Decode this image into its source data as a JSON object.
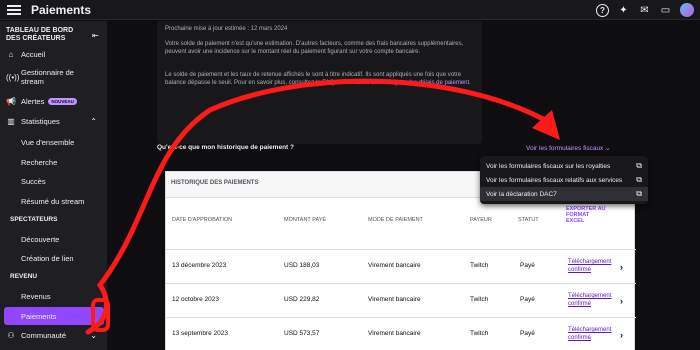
{
  "topbar": {
    "title": "Paiements",
    "icons": [
      "menu-icon",
      "help-icon",
      "sparkle-icon",
      "inbox-icon",
      "chat-icon",
      "avatar"
    ]
  },
  "sidebar": {
    "heading": "TABLEAU DE BORD DES CRÉATEURS",
    "collapse_icon": "collapse-icon",
    "items": [
      {
        "label": "Accueil",
        "icon": "home-icon"
      },
      {
        "label": "Gestionnaire de stream",
        "icon": "broadcast-icon"
      },
      {
        "label": "Alertes",
        "icon": "megaphone-icon",
        "badge": "NOUVEAU"
      },
      {
        "label": "Statistiques",
        "icon": "stats-icon"
      }
    ],
    "stats_sub": [
      "Vue d'ensemble",
      "Recherche",
      "Succès",
      "Résumé du stream"
    ],
    "section_spectateurs": "SPECTATEURS",
    "spect_sub": [
      "Découverte",
      "Création de lien"
    ],
    "section_revenu": "REVENU",
    "revenu_sub": [
      "Revenus",
      "Paiements"
    ],
    "community": "Communauté"
  },
  "infobox": {
    "line0": "Prochaine mise à jour estimée : 12 mars 2024",
    "para1": "Votre solde de paiement n'est qu'une estimation. D'autres facteurs, comme des frais bancaires supplémentaires, peuvent avoir une incidence sur le montant réel du paiement figurant sur votre compte bancaire.",
    "para2_text": "Le solde de paiement et les taux de retenue affichés le sont à titre indicatif. Ils sont appliqués une fois que votre balance dépasse le seuil. Pour en savoir plus, consultez la",
    "para2_link": "FAQ sur les taxes ou la FAQ sur les délais de paiement."
  },
  "history_question": "Qu'est-ce que mon historique de paiement ?",
  "fiscal_link": "Voir les formulaires fiscaux",
  "dropdown": [
    "Voir les formulaires fiscaux sur les royalties",
    "Voir les formulaires fiscaux relatifs aux services",
    "Voir la déclaration DAC7"
  ],
  "table": {
    "title": "HISTORIQUE DES PAIEMENTS",
    "headers": [
      "DATE D'APPROBATION",
      "MONTANT PAYÉ",
      "MODE DE PAIEMENT",
      "PAYEUR",
      "STATUT"
    ],
    "export_label": "EXPORTER AU FORMAT EXCEL",
    "rows": [
      {
        "date": "13 décembre 2023",
        "amount": "USD 188,03",
        "method": "Virement bancaire",
        "payer": "Twitch",
        "status": "Payé",
        "download": "Téléchargement confirmé"
      },
      {
        "date": "12 octobre 2023",
        "amount": "USD 229,82",
        "method": "Virement bancaire",
        "payer": "Twitch",
        "status": "Payé",
        "download": "Téléchargement confirmé"
      },
      {
        "date": "13 septembre 2023",
        "amount": "USD 573,57",
        "method": "Virement bancaire",
        "payer": "Twitch",
        "status": "Payé",
        "download": "Téléchargement confirmé"
      }
    ]
  },
  "colors": {
    "accent": "#9147ff",
    "link": "#bf94ff",
    "annotation": "#ff1a1a"
  }
}
